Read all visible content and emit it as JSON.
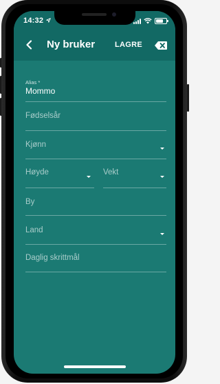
{
  "status_bar": {
    "time": "14:32",
    "battery_level": 0.7
  },
  "header": {
    "title": "Ny bruker",
    "save_label": "LAGRE",
    "back_icon": "chevron-left-icon",
    "clear_icon": "backspace-icon"
  },
  "form": {
    "alias": {
      "label": "Alias *",
      "value": "Mommo"
    },
    "birth_year": {
      "label": "Fødselsår"
    },
    "gender": {
      "label": "Kjønn"
    },
    "height": {
      "label": "Høyde"
    },
    "weight": {
      "label": "Vekt"
    },
    "city": {
      "label": "By"
    },
    "country": {
      "label": "Land"
    },
    "daily_step_goal": {
      "label": "Daglig skrittmål"
    }
  },
  "colors": {
    "background": "#1b7a73",
    "header": "#126964",
    "text": "#ffffff"
  }
}
